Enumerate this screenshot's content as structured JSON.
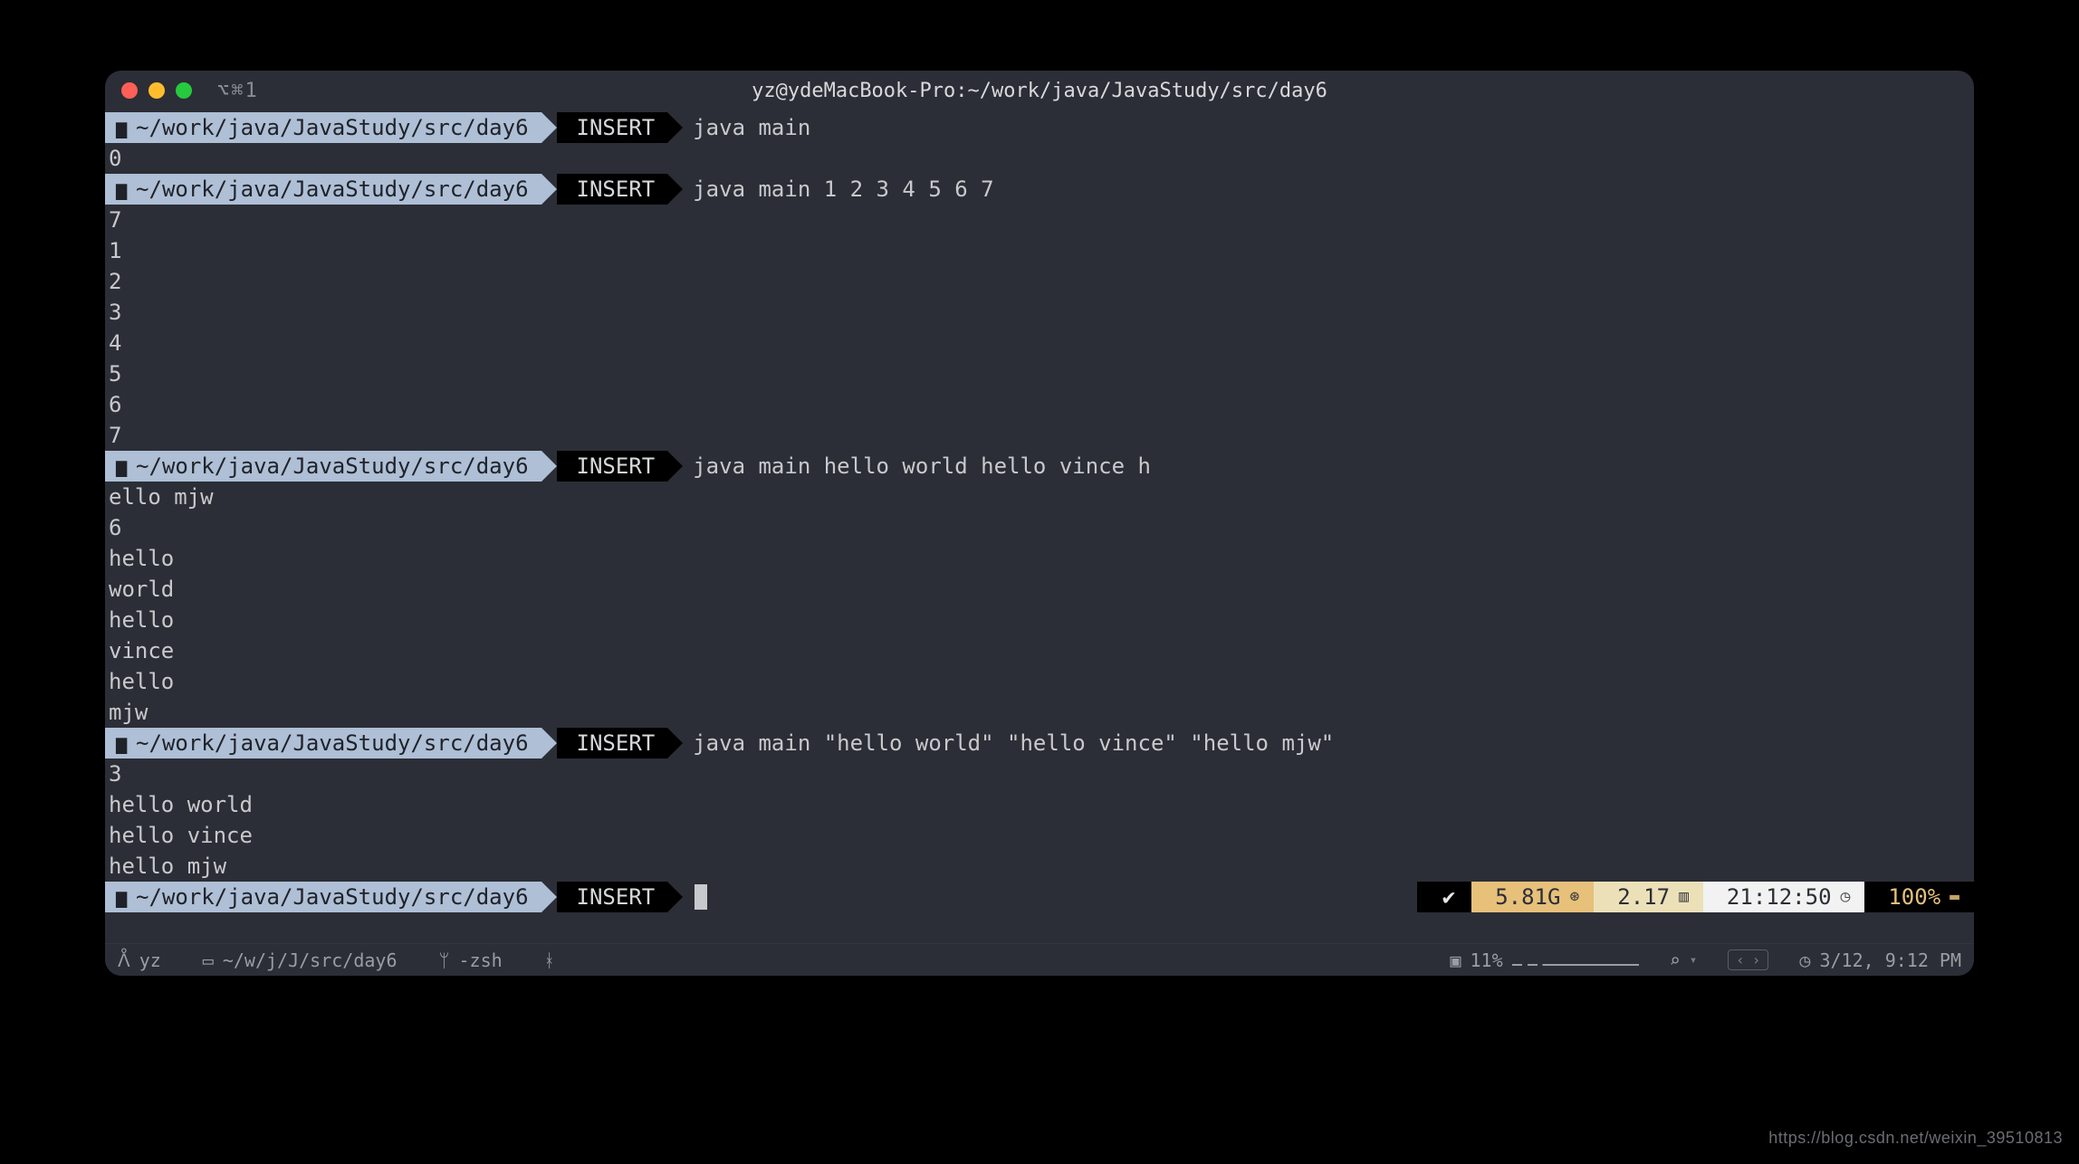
{
  "titlebar": {
    "tab_label": "⌥⌘1",
    "title": "yz@ydeMacBook-Pro:~/work/java/JavaStudy/src/day6"
  },
  "prompt": {
    "path": "~/work/java/JavaStudy/src/day6",
    "mode": "INSERT"
  },
  "blocks": [
    {
      "cmd": "java main",
      "output": [
        "0"
      ]
    },
    {
      "cmd": "java main 1 2 3 4 5 6 7",
      "output": [
        "7",
        "1",
        "2",
        "3",
        "4",
        "5",
        "6",
        "7"
      ]
    },
    {
      "cmd": "java main hello world hello vince h",
      "output": [
        "ello mjw",
        "6",
        "hello",
        "world",
        "hello",
        "vince",
        "hello",
        "mjw"
      ]
    },
    {
      "cmd": "java main \"hello world\" \"hello vince\" \"hello mjw\"",
      "output": [
        "3",
        "hello world",
        "hello vince",
        "hello mjw"
      ]
    }
  ],
  "right_status": {
    "ok_icon": "✔",
    "mem": "5.81G",
    "mem_icon": "⊛",
    "load": "2.17",
    "load_icon": "▥",
    "time": "21:12:50",
    "time_icon": "◷",
    "battery": "100%",
    "battery_icon": "▬"
  },
  "statusbar": {
    "user_icon": "ᐰ",
    "user": "yz",
    "folder_icon": "▭",
    "folder": "~/w/j/J/src/day6",
    "branch_icon": "ᛘ",
    "shell": "-zsh",
    "cpu_icon": "▣",
    "cpu": "11%",
    "search_icon": "⌕",
    "search_caret": "▾",
    "pager_prev": "‹",
    "pager_next": "›",
    "clock_icon": "◷",
    "clock": "3/12, 9:12 PM"
  },
  "watermark": "https://blog.csdn.net/weixin_39510813",
  "git_glyph": "ᚼ"
}
